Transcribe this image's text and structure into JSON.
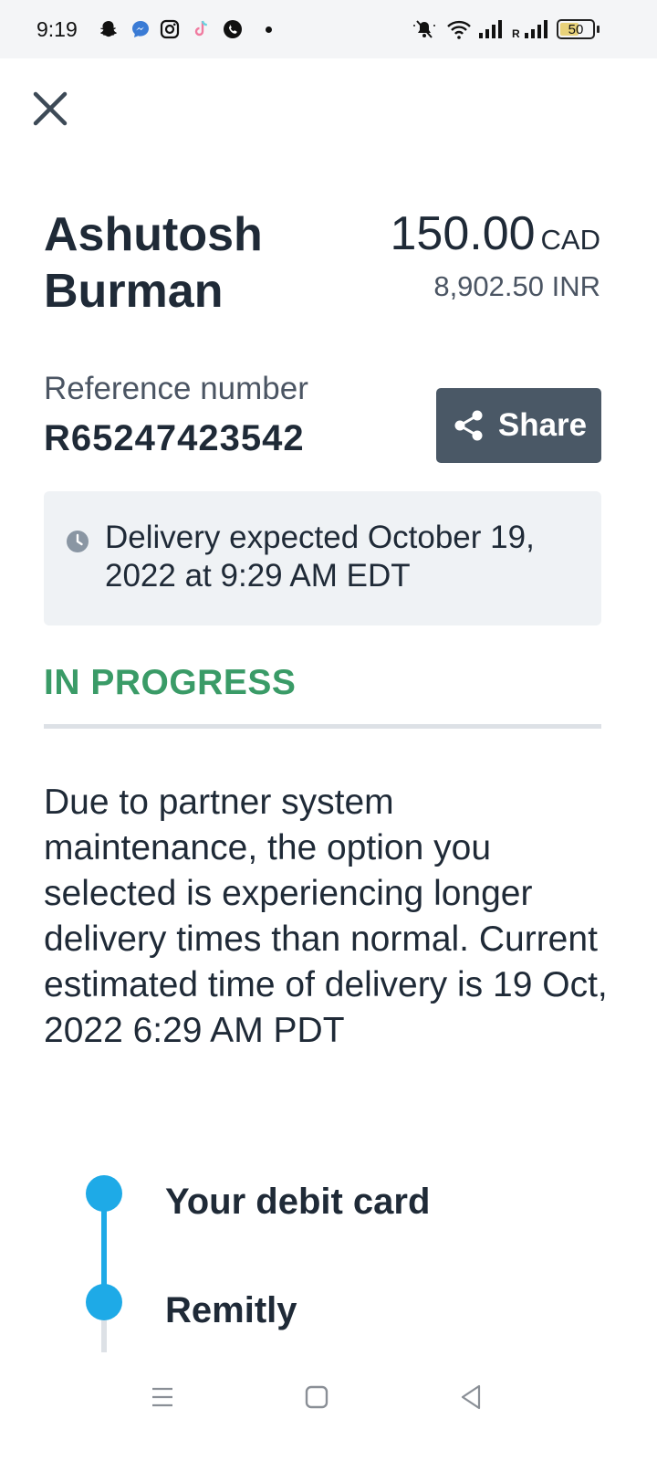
{
  "status_bar": {
    "time": "9:19",
    "battery": "50",
    "roaming_indicator": "R",
    "notification_icons": [
      "snapchat-icon",
      "messenger-icon",
      "instagram-icon",
      "tiktok-icon",
      "whatsapp-icon"
    ],
    "system_icons": [
      "mute-icon",
      "wifi-icon",
      "signal-icon",
      "signal-roaming-icon",
      "battery-icon"
    ]
  },
  "header": {
    "recipient_name": "Ashutosh Burman",
    "amount": "150.00",
    "amount_currency": "CAD",
    "converted_amount": "8,902.50 INR"
  },
  "reference": {
    "label": "Reference number",
    "value": "R65247423542"
  },
  "share_button": {
    "label": "Share"
  },
  "delivery": {
    "text": "Delivery expected October 19, 2022 at 9:29 AM EDT"
  },
  "status": {
    "label": "IN PROGRESS",
    "color": "#3a9b67"
  },
  "notice": {
    "text": "Due to partner system maintenance, the option you selected is experiencing longer delivery times than normal. Current estimated time of delivery is 19 Oct, 2022 6:29 AM PDT"
  },
  "timeline": {
    "steps": [
      {
        "label": "Your debit card"
      },
      {
        "label": "Remitly"
      }
    ],
    "active_color": "#1eaae7"
  },
  "colors": {
    "primary_text": "#1f2a37",
    "share_button_bg": "#4a5866",
    "delivery_box_bg": "#eff2f5"
  }
}
